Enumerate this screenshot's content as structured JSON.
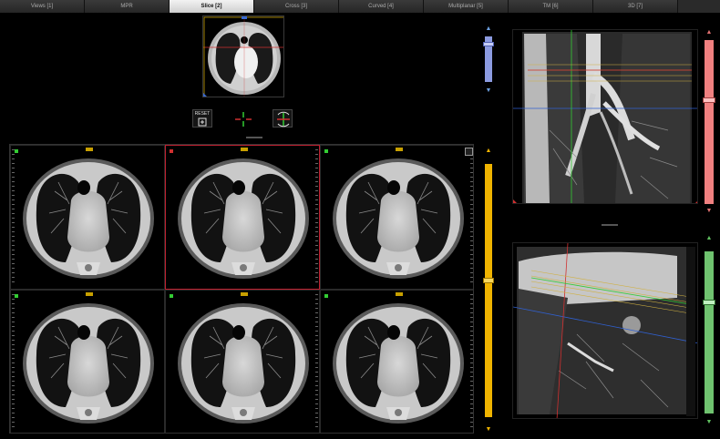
{
  "tabs": [
    {
      "label": "Views [1]"
    },
    {
      "label": "MPR"
    },
    {
      "label": "Slice [2]"
    },
    {
      "label": "Cross [3]"
    },
    {
      "label": "Curved [4]"
    },
    {
      "label": "Multiplanar [5]"
    },
    {
      "label": "TM [6]"
    },
    {
      "label": "3D [7]"
    }
  ],
  "active_tab_index": 2,
  "toolbar": {
    "reset_label": "RESET"
  },
  "colors": {
    "accent_active_tab": "#e0e0e0",
    "slice_slider": "#f0b400",
    "top_slider": "#8c9be0",
    "coronal_slider": "#f08080",
    "sagittal_slider": "#6fc26f",
    "active_cell_border": "#c02030"
  },
  "sliders": {
    "slice_level": 0.45,
    "top_level": 0.12,
    "coronal_level": 0.35,
    "sagittal_level": 0.3
  },
  "icons": [
    "reset-icon",
    "crosshair-icon",
    "rotate-icon",
    "up-arrow-icon",
    "down-arrow-icon",
    "layout-icon"
  ]
}
